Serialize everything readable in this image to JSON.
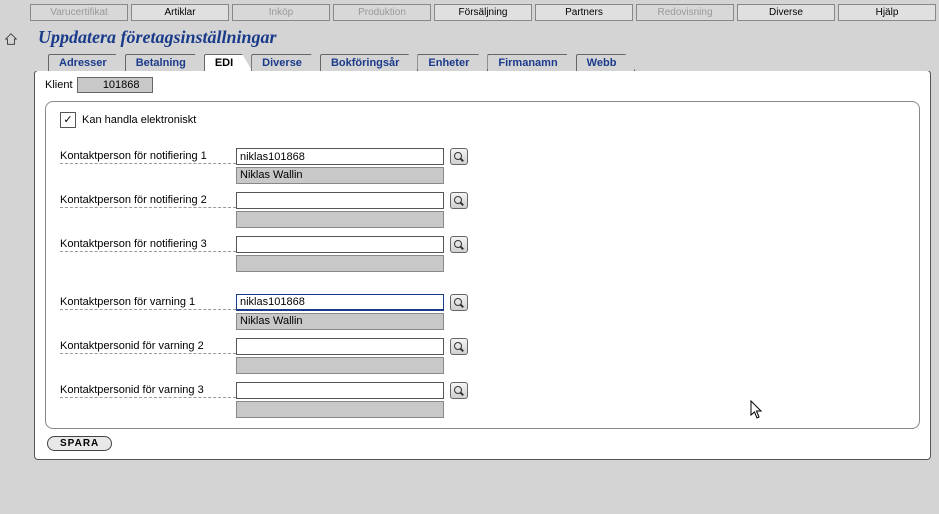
{
  "topTabs": [
    {
      "label": "Varucertifikat",
      "state": "disabled"
    },
    {
      "label": "Artiklar",
      "state": "normal"
    },
    {
      "label": "Inköp",
      "state": "disabled"
    },
    {
      "label": "Produktion",
      "state": "disabled"
    },
    {
      "label": "Försäljning",
      "state": "normal"
    },
    {
      "label": "Partners",
      "state": "normal"
    },
    {
      "label": "Redovisning",
      "state": "disabled"
    },
    {
      "label": "Diverse",
      "state": "normal"
    },
    {
      "label": "Hjälp",
      "state": "normal"
    }
  ],
  "title": "Uppdatera företagsinställningar",
  "subTabs": [
    {
      "label": "Adresser",
      "active": false
    },
    {
      "label": "Betalning",
      "active": false
    },
    {
      "label": "EDI",
      "active": true
    },
    {
      "label": "Diverse",
      "active": false
    },
    {
      "label": "Bokföringsår",
      "active": false
    },
    {
      "label": "Enheter",
      "active": false
    },
    {
      "label": "Firmanamn",
      "active": false
    },
    {
      "label": "Webb",
      "active": false
    }
  ],
  "klient": {
    "label": "Klient",
    "value": "101868"
  },
  "checkbox": {
    "label": "Kan handla elektroniskt",
    "checked": true
  },
  "fields": {
    "notif1": {
      "label": "Kontaktperson för notifiering 1",
      "value": "niklas101868",
      "display": "Niklas Wallin"
    },
    "notif2": {
      "label": "Kontaktperson för notifiering 2",
      "value": "",
      "display": ""
    },
    "notif3": {
      "label": "Kontaktperson för notifiering 3",
      "value": "",
      "display": ""
    },
    "warn1": {
      "label": "Kontaktperson för varning 1",
      "value": "niklas101868",
      "display": "Niklas Wallin"
    },
    "warn2": {
      "label": "Kontaktpersonid för varning 2",
      "value": "",
      "display": ""
    },
    "warn3": {
      "label": "Kontaktpersonid för varning 3",
      "value": "",
      "display": ""
    }
  },
  "saveLabel": "SPARA"
}
